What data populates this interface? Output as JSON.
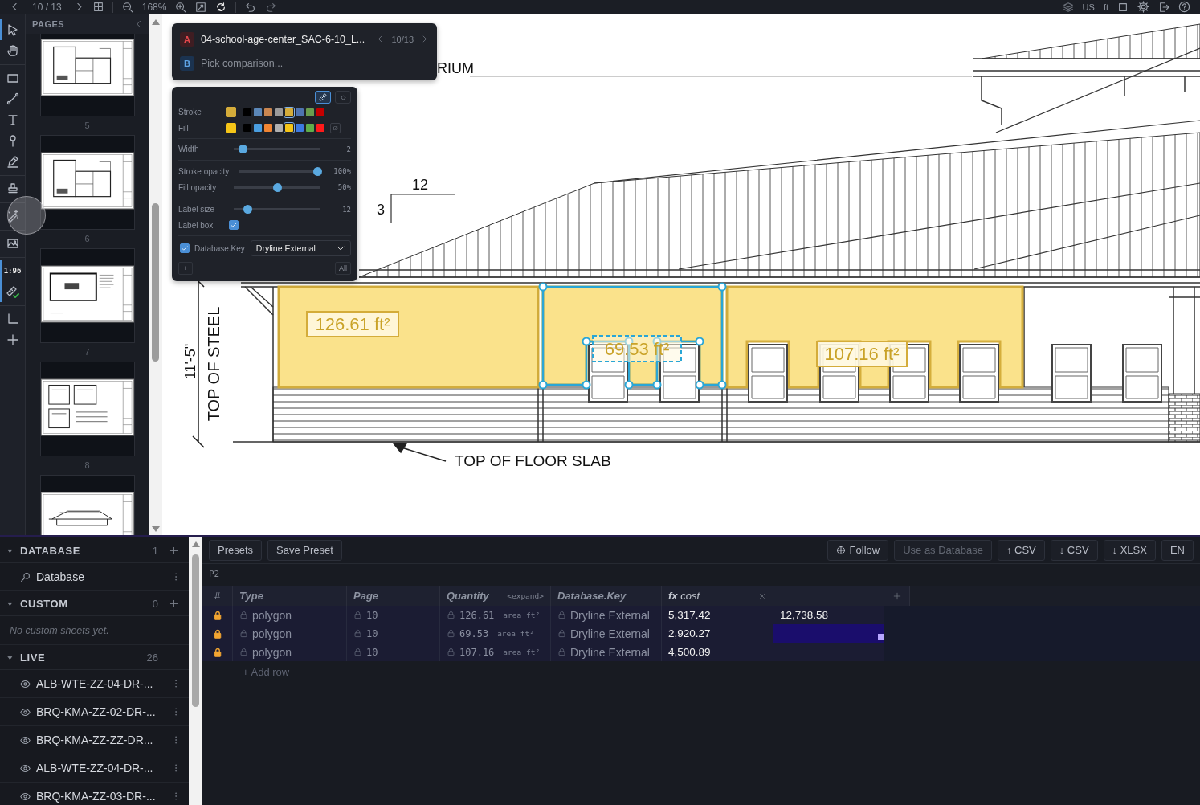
{
  "toolbar": {
    "page_counter": "10 / 13",
    "zoom": "168%",
    "units": [
      {
        "label": "US"
      },
      {
        "label": "ft"
      }
    ]
  },
  "tool_groups": [
    [
      {
        "kind": "select",
        "selected": true
      },
      {
        "kind": "hand",
        "selected": false
      }
    ],
    [
      {
        "kind": "rectangle",
        "selected": false
      },
      {
        "kind": "line",
        "selected": false
      },
      {
        "kind": "text",
        "selected": false
      },
      {
        "kind": "pin",
        "selected": false
      },
      {
        "kind": "pencil",
        "selected": false
      }
    ],
    [
      {
        "kind": "stamp",
        "selected": false
      }
    ],
    [
      {
        "kind": "magic",
        "selected": false
      }
    ],
    [
      {
        "kind": "image",
        "selected": false
      }
    ],
    [
      {
        "kind": "scale",
        "label": "1:96",
        "selected": true
      },
      {
        "kind": "ruler",
        "selected": true
      }
    ],
    [
      {
        "kind": "angle",
        "selected": false
      },
      {
        "kind": "add",
        "selected": false
      }
    ]
  ],
  "pages": {
    "title": "PAGES",
    "thumbnails": [
      {
        "kind": "plan",
        "label": "5"
      },
      {
        "kind": "plan",
        "label": "6"
      },
      {
        "kind": "kitchen",
        "label": "7"
      },
      {
        "kind": "details",
        "label": "8"
      },
      {
        "kind": "elevation"
      }
    ]
  },
  "compare": {
    "a": {
      "badge": "A",
      "name": "04-school-age-center_SAC-6-10_L...",
      "counter": "10/13"
    },
    "b": {
      "badge": "B",
      "placeholder": "Pick comparison..."
    }
  },
  "style_panel": {
    "linked": true,
    "stroke": {
      "label": "Stroke",
      "swatches": [
        {
          "color": "#000000",
          "selected": false
        },
        {
          "color": "#5b87b8",
          "selected": false
        },
        {
          "color": "#c98650",
          "selected": false
        },
        {
          "color": "#9a9a9a",
          "selected": false
        },
        {
          "color": "#d4ac3a",
          "selected": true
        },
        {
          "color": "#4f74b0",
          "selected": false
        },
        {
          "color": "#6a9e4f",
          "selected": false
        },
        {
          "color": "#c40000",
          "selected": false
        }
      ]
    },
    "fill": {
      "label": "Fill",
      "none_label": "Ø",
      "swatches": [
        {
          "color": "#000000",
          "selected": false
        },
        {
          "color": "#4a9ee0",
          "selected": false
        },
        {
          "color": "#f08533",
          "selected": false
        },
        {
          "color": "#b0b0b0",
          "selected": false
        },
        {
          "color": "#f5c518",
          "selected": true
        },
        {
          "color": "#3d7ae0",
          "selected": false
        },
        {
          "color": "#5fae4a",
          "selected": false
        },
        {
          "color": "#ff1a1a",
          "selected": false
        }
      ]
    },
    "sliders": [
      {
        "label": "Width",
        "level": 0.1,
        "reading": "2"
      },
      {
        "label": "Stroke opacity",
        "level": 0.97,
        "reading": "100%"
      },
      {
        "label": "Fill opacity",
        "level": 0.5,
        "reading": "50%"
      },
      {
        "label": "Label size",
        "level": 0.16,
        "reading": "12"
      }
    ],
    "label_box": {
      "label": "Label box",
      "checked": true
    },
    "database_key": {
      "label": "Database.Key",
      "checked": true,
      "value": "Dryline External"
    },
    "add_label": "+",
    "all_label": "All"
  },
  "drawing": {
    "labels": [
      {
        "kind": "title",
        "text": "RIUM"
      },
      {
        "kind": "slope_run",
        "text": "12"
      },
      {
        "kind": "slope_rise",
        "text": "3"
      },
      {
        "kind": "dimension",
        "text": "11'-5\""
      },
      {
        "kind": "level",
        "text": "TOP OF STEEL"
      },
      {
        "kind": "leader",
        "text": "TOP OF FLOOR SLAB"
      }
    ],
    "measurements": [
      {
        "label": "126.61 ft²",
        "selected": false
      },
      {
        "label": "69.53 ft²",
        "selected": true
      },
      {
        "label": "107.16 ft²",
        "selected": false
      }
    ]
  },
  "sheets": {
    "sections": [
      {
        "title": "DATABASE",
        "count": "1",
        "expanded": true,
        "addable": true,
        "items": [
          {
            "kind": "database",
            "label": "Database"
          }
        ]
      },
      {
        "title": "CUSTOM",
        "count": "0",
        "expanded": true,
        "addable": true,
        "empty_text": "No custom sheets yet."
      },
      {
        "title": "LIVE",
        "count": "26",
        "expanded": true,
        "addable": false,
        "items": [
          {
            "kind": "live",
            "label": "ALB-WTE-ZZ-04-DR-..."
          },
          {
            "kind": "live",
            "label": "BRQ-KMA-ZZ-02-DR-..."
          },
          {
            "kind": "live",
            "label": "BRQ-KMA-ZZ-ZZ-DR..."
          },
          {
            "kind": "live",
            "label": "ALB-WTE-ZZ-04-DR-..."
          },
          {
            "kind": "live",
            "label": "BRQ-KMA-ZZ-03-DR-..."
          }
        ]
      }
    ]
  },
  "table_toolbar": {
    "left": [
      {
        "label": "Presets"
      },
      {
        "label": "Save Preset"
      }
    ],
    "right": [
      {
        "kind": "follow",
        "label": "Follow",
        "disabled": false
      },
      {
        "kind": "plain",
        "label": "Use as Database",
        "disabled": true
      },
      {
        "kind": "plain",
        "label": "↑ CSV",
        "disabled": false
      },
      {
        "kind": "plain",
        "label": "↓ CSV",
        "disabled": false
      },
      {
        "kind": "plain",
        "label": "↓ XLSX",
        "disabled": false
      },
      {
        "kind": "plain",
        "label": "EN",
        "disabled": false
      }
    ]
  },
  "sheet_label": "P2",
  "table": {
    "columns": [
      {
        "kind": "index",
        "label": "#"
      },
      {
        "kind": "field",
        "label": "Type"
      },
      {
        "kind": "field",
        "label": "Page"
      },
      {
        "kind": "field",
        "label": "Quantity",
        "hint": "<expand>"
      },
      {
        "kind": "field",
        "label": "Database.Key"
      },
      {
        "kind": "formula",
        "label": "**fx** cost",
        "closable": true
      },
      {
        "kind": "empty"
      }
    ],
    "rows": [
      {
        "locked": true,
        "type": "polygon",
        "page": "10",
        "quantity": "126.61",
        "unit": "area ft²",
        "key": "Dryline External",
        "cost": "5,317.42",
        "column_7": "12,738.58",
        "column_7_selected": false
      },
      {
        "locked": true,
        "type": "polygon",
        "page": "10",
        "quantity": "69.53",
        "unit": "area ft²",
        "key": "Dryline External",
        "cost": "2,920.27",
        "column_7_selected": true
      },
      {
        "locked": true,
        "type": "polygon",
        "page": "10",
        "quantity": "107.16",
        "unit": "area ft²",
        "key": "Dryline External",
        "cost": "4,500.89",
        "column_7_selected": false
      }
    ],
    "add_row": "+ Add row"
  }
}
